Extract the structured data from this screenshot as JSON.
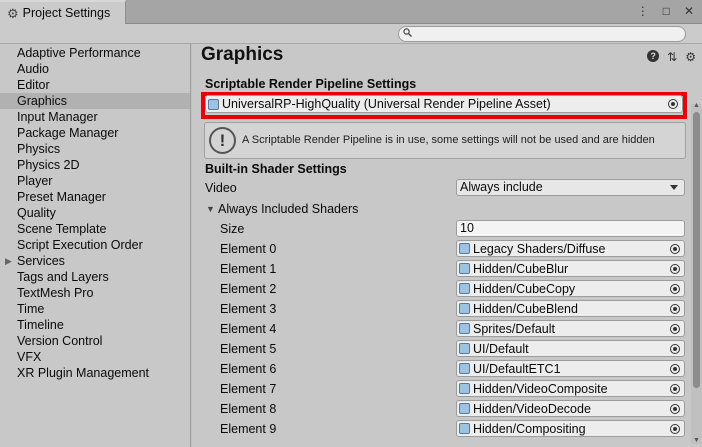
{
  "window": {
    "tab_title": "Project Settings",
    "window_buttons": [
      "⋮",
      "□",
      "✕"
    ]
  },
  "search": {
    "placeholder": ""
  },
  "sidebar": {
    "items": [
      {
        "label": "Adaptive Performance"
      },
      {
        "label": "Audio"
      },
      {
        "label": "Editor"
      },
      {
        "label": "Graphics",
        "selected": true
      },
      {
        "label": "Input Manager"
      },
      {
        "label": "Package Manager"
      },
      {
        "label": "Physics"
      },
      {
        "label": "Physics 2D"
      },
      {
        "label": "Player"
      },
      {
        "label": "Preset Manager"
      },
      {
        "label": "Quality"
      },
      {
        "label": "Scene Template"
      },
      {
        "label": "Script Execution Order"
      },
      {
        "label": "Services",
        "expandable": true
      },
      {
        "label": "Tags and Layers"
      },
      {
        "label": "TextMesh Pro"
      },
      {
        "label": "Time"
      },
      {
        "label": "Timeline"
      },
      {
        "label": "Version Control"
      },
      {
        "label": "VFX"
      },
      {
        "label": "XR Plugin Management"
      }
    ]
  },
  "main": {
    "title": "Graphics",
    "srp_section": "Scriptable Render Pipeline Settings",
    "srp_asset": "UniversalRP-HighQuality (Universal Render Pipeline Asset)",
    "info_message": "A Scriptable Render Pipeline is in use, some settings will not be used and are hidden",
    "builtin_section": "Built-in Shader Settings",
    "video_label": "Video",
    "video_value": "Always include",
    "shaders_foldout": "Always Included Shaders",
    "size_label": "Size",
    "size_value": "10",
    "elements": [
      {
        "label": "Element 0",
        "value": "Legacy Shaders/Diffuse"
      },
      {
        "label": "Element 1",
        "value": "Hidden/CubeBlur"
      },
      {
        "label": "Element 2",
        "value": "Hidden/CubeCopy"
      },
      {
        "label": "Element 3",
        "value": "Hidden/CubeBlend"
      },
      {
        "label": "Element 4",
        "value": "Sprites/Default"
      },
      {
        "label": "Element 5",
        "value": "UI/Default"
      },
      {
        "label": "Element 6",
        "value": "UI/DefaultETC1"
      },
      {
        "label": "Element 7",
        "value": "Hidden/VideoComposite"
      },
      {
        "label": "Element 8",
        "value": "Hidden/VideoDecode"
      },
      {
        "label": "Element 9",
        "value": "Hidden/Compositing"
      }
    ]
  },
  "colors": {
    "highlight": "#e8000a",
    "selected_item": "#b1b1b1"
  }
}
